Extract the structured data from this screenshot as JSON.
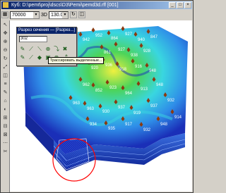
{
  "window": {
    "title": "Куб: D:\\pemt\\proj\\dscs\\D3\\Pemi\\pemd3d.rff [001]",
    "buttons": {
      "minimize": "_",
      "maximize": "□",
      "close": "×"
    }
  },
  "toolbar": {
    "scale_value": "70000",
    "angle_label": "3D",
    "angle_value": "130.0"
  },
  "left_tools": [
    "↖",
    "✥",
    "⊕",
    "⊖",
    "↻",
    "⤢",
    "◫",
    "≡",
    "✎",
    "⌂",
    "◐",
    "⊞",
    "⊟",
    "⊠",
    "⋯",
    "✂"
  ],
  "panel": {
    "title": "Разрез сечения — [Разрез...]",
    "input_value": "302",
    "icons": [
      "✎",
      "⟋",
      "⟍",
      "⊕",
      "⤵",
      "✖",
      "✎",
      "⟋",
      "◆",
      "▣",
      "⊗",
      "⤴"
    ],
    "tooltip": "Трассировать выделенные..."
  },
  "well_labels": [
    "942",
    "952",
    "864",
    "927",
    "940",
    "847",
    "861",
    "927",
    "938",
    "928",
    "920",
    "936",
    "918",
    "916",
    "948",
    "962",
    "852",
    "923",
    "964",
    "913",
    "948",
    "963",
    "963",
    "930",
    "937",
    "919",
    "937",
    "932",
    "934",
    "935",
    "917",
    "932",
    "948",
    "914"
  ],
  "colors": {
    "deep_blue": "#1a2fb8",
    "mid_blue": "#2f8ee8",
    "cyan": "#39d6e0",
    "green": "#4cd45a",
    "yellow": "#f0f040",
    "highlight_red": "#ff0000"
  }
}
